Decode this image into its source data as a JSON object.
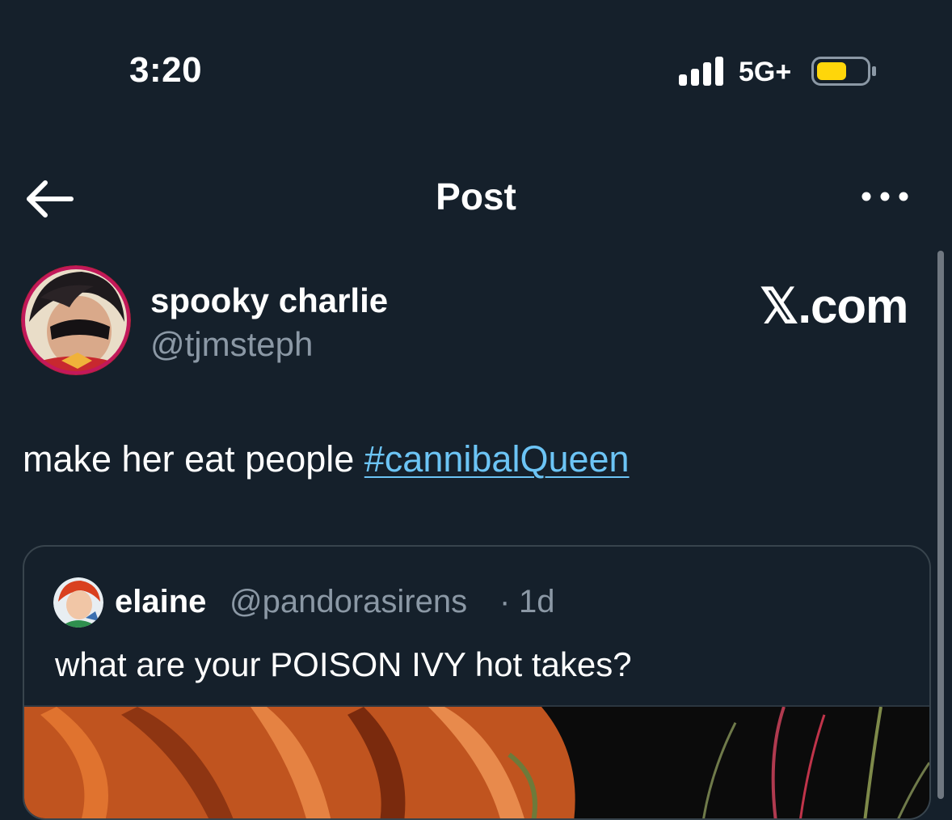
{
  "status_bar": {
    "time": "3:20",
    "network": "5G+",
    "battery_color": "#ffd60a"
  },
  "nav": {
    "title": "Post",
    "back_icon": "back-arrow-icon",
    "more_icon": "more-horizontal-icon"
  },
  "post": {
    "author": {
      "display_name": "spooky charlie",
      "handle": "@tjmsteph"
    },
    "watermark": "𝕏.com",
    "text": "make her eat people ",
    "hashtag": "#cannibalQueen",
    "hashtag_color": "#6cc4f5"
  },
  "quoted_post": {
    "author": {
      "display_name": "elaine",
      "handle": "@pandorasirens"
    },
    "separator": "·",
    "time": "1d",
    "text": "what are your POISON IVY hot takes?"
  },
  "colors": {
    "background": "#15202b",
    "secondary_text": "#8b98a5",
    "border": "#38444d"
  }
}
